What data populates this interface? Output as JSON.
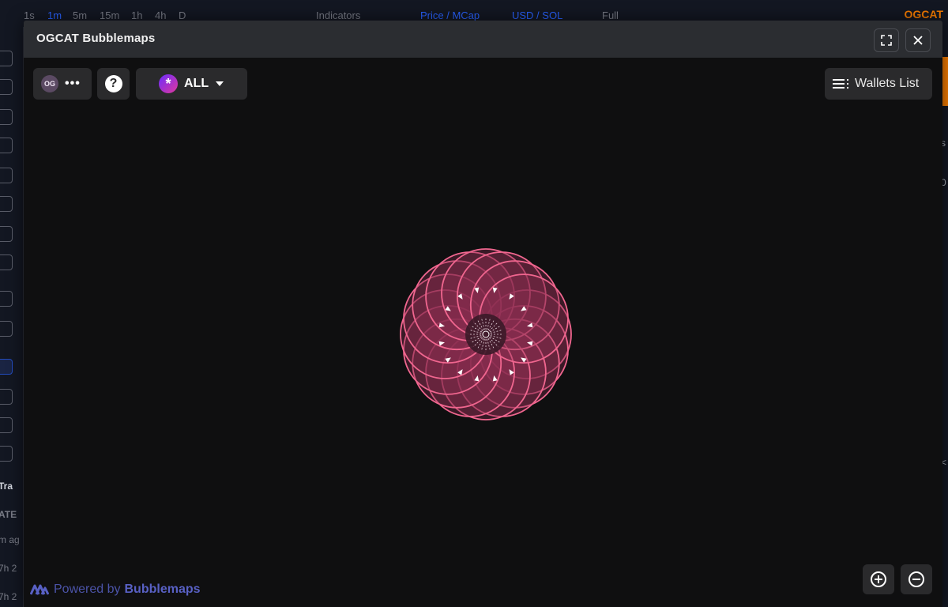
{
  "background": {
    "topbar": [
      "1s",
      "1m",
      "5m",
      "15m",
      "1h",
      "4h",
      "D",
      "Indicators",
      "Price / MCap",
      "USD / SOL",
      "Full"
    ],
    "brand": "OGCAT",
    "left_text": [
      "Tra",
      "ATE",
      "m ag",
      "7h 2",
      "7h 2"
    ]
  },
  "modal": {
    "title": "OGCAT Bubblemaps",
    "toolbar": {
      "token_badge": "OG",
      "more": "•••",
      "help": "?",
      "filter_icon": "*",
      "filter_label": "ALL",
      "wallets_list": "Wallets List"
    },
    "footer": {
      "powered_by": "Powered by",
      "brand": "Bubblemaps"
    }
  },
  "colors": {
    "bubble_stroke": "#f0668f",
    "bubble_fill": "#8a2f4f",
    "modal_bg": "#0f0f10",
    "header_bg": "#2b2d31",
    "brand_blue": "#5860c4"
  },
  "icons": {
    "fullscreen": "expand-corners-icon",
    "close": "close-icon",
    "zoom_in": "plus-circle-icon",
    "zoom_out": "minus-circle-icon",
    "list": "list-icon",
    "logo": "bubblemaps-logo-icon"
  }
}
